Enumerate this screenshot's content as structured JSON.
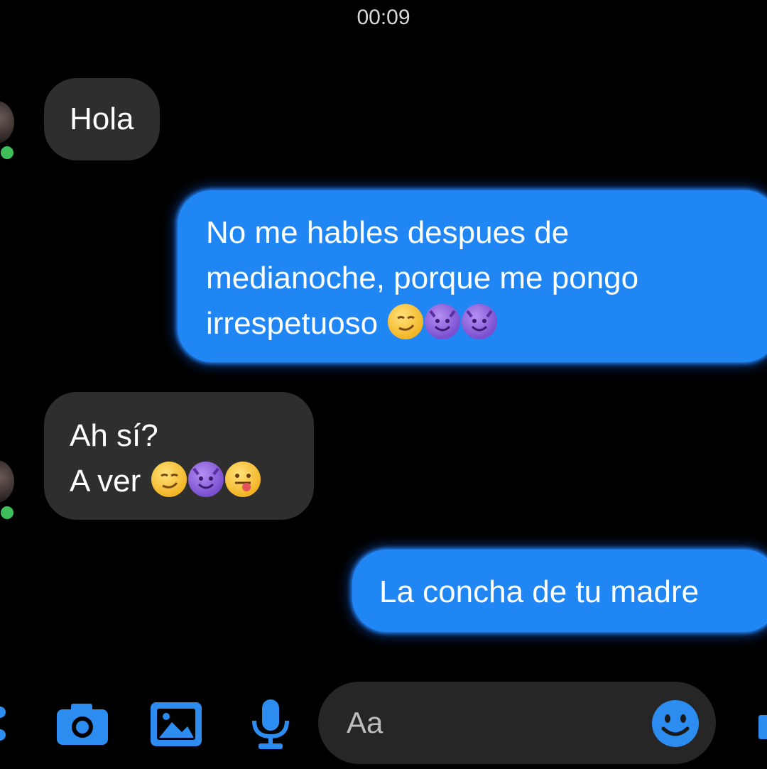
{
  "header": {
    "time": "00:09"
  },
  "messages": [
    {
      "side": "in",
      "lines": [
        "Hola"
      ]
    },
    {
      "side": "out",
      "lines": [
        "No me hables despues de",
        "medianoche, porque me pongo",
        "irrespetuoso"
      ],
      "emojis": [
        "smirk-emoji",
        "smiling-devil-emoji",
        "smiling-devil-emoji"
      ]
    },
    {
      "side": "in",
      "lines": [
        "Ah sí?",
        "A ver"
      ],
      "emojis": [
        "smirk-emoji",
        "smiling-devil-emoji",
        "tongue-out-emoji"
      ]
    },
    {
      "side": "out",
      "lines": [
        "La concha de tu madre"
      ]
    }
  ],
  "composer": {
    "placeholder": "Aa",
    "icons": [
      "more-icon",
      "camera-icon",
      "gallery-icon",
      "microphone-icon",
      "emoji-icon",
      "like-icon"
    ]
  },
  "colors": {
    "outgoing_bubble": "#1f86f4",
    "incoming_bubble": "#2e2e2e",
    "accent": "#2d8cf0",
    "online": "#3fbf5a",
    "background": "#000000"
  }
}
